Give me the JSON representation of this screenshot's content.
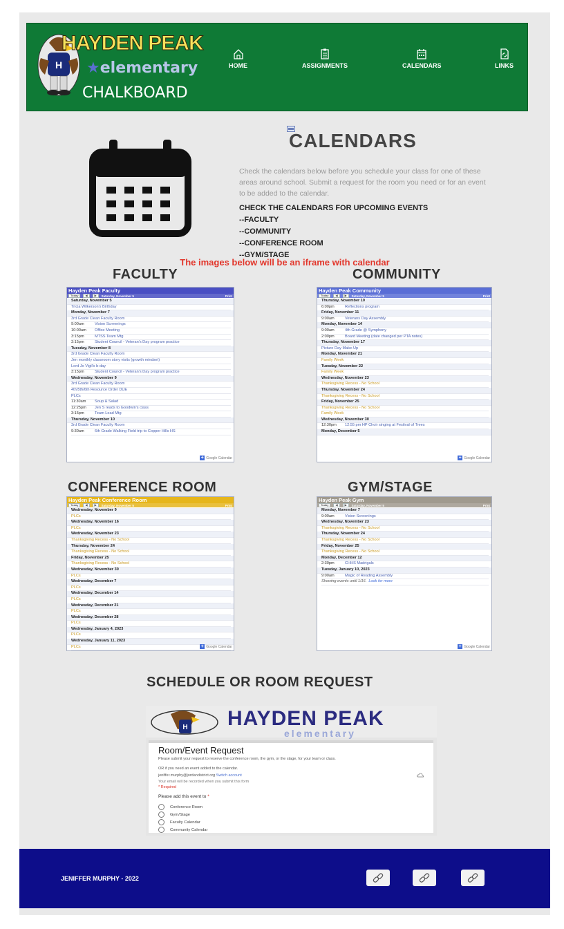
{
  "header": {
    "logo": {
      "line1": "HAYDEN PEAK",
      "line2": "elementary",
      "line3": "CHALKBOARD"
    },
    "nav": [
      {
        "label": "HOME",
        "icon": "home-icon"
      },
      {
        "label": "ASSIGNMENTS",
        "icon": "clipboard-icon"
      },
      {
        "label": "CALENDARS",
        "icon": "calendar-icon"
      },
      {
        "label": "LINKS",
        "icon": "link-doc-icon"
      }
    ]
  },
  "hero": {
    "title": "CALENDARS",
    "description": "Check the calendars below before you schedule your class for one of these areas around school. Submit a request for the room you need or for an event to be added to the calendar.",
    "list_heading": "CHECK THE CALENDARS FOR UPCOMING EVENTS",
    "list": [
      "--FACULTY",
      "--COMMUNITY",
      "--CONFERENCE ROOM",
      "--GYM/STAGE"
    ]
  },
  "notice": "The images below will be an iframe with calendar",
  "calendars": {
    "faculty": {
      "section_title": "FACULTY",
      "name": "Hayden Peak Faculty",
      "date": "Saturday, November 5",
      "rows": [
        {
          "day": "Saturday, November 5"
        },
        {
          "text": "Tricia Wilkerson's Birthday"
        },
        {
          "day": "Monday, November 7"
        },
        {
          "text": "3rd Grade Clean Faculty Room"
        },
        {
          "time": "9:00am",
          "text": "Vision Screenings"
        },
        {
          "time": "10:00am",
          "text": "Office Meeting"
        },
        {
          "time": "3:15pm",
          "text": "MTSS Team Mtg"
        },
        {
          "time": "3:15pm",
          "text": "Student Council - Veteran's Day program practice"
        },
        {
          "day": "Tuesday, November 8"
        },
        {
          "text": "3rd Grade Clean Faculty Room"
        },
        {
          "text": "Jen monthly classroom story visits (growth mindset)"
        },
        {
          "text": "Lord Jo Vigil's b-day"
        },
        {
          "time": "3:15pm",
          "text": "Student Council - Veteran's Day program practice"
        },
        {
          "day": "Wednesday, November 9"
        },
        {
          "text": "3rd Grade Clean Faculty Room"
        },
        {
          "text": "4th/5th/6th Resource Order DUE"
        },
        {
          "text": "PLCs"
        },
        {
          "time": "11:30am",
          "text": "Soup & Salad"
        },
        {
          "time": "12:25pm",
          "text": "Jen S reads to Goodwin's class"
        },
        {
          "time": "3:15pm",
          "text": "Team Lead Mtg"
        },
        {
          "day": "Thursday, November 10"
        },
        {
          "text": "3rd Grade Clean Faculty Room"
        },
        {
          "time": "9:30am",
          "text": "6th Grade Walking Field trip to Copper Hills HS"
        }
      ]
    },
    "community": {
      "section_title": "COMMUNITY",
      "name": "Hayden Peak Community",
      "date": "Saturday, November 5",
      "rows": [
        {
          "day": "Thursday, November 10"
        },
        {
          "time": "6:00pm",
          "text": "Reflections program"
        },
        {
          "day": "Friday, November 11"
        },
        {
          "time": "9:00am",
          "text": "Veterans Day Assembly"
        },
        {
          "day": "Monday, November 14"
        },
        {
          "time": "9:00am",
          "text": "4th Grade @ Symphony"
        },
        {
          "time": "2:00pm",
          "text": "Board Meeting (date changed per PTA notes)"
        },
        {
          "day": "Thursday, November 17"
        },
        {
          "text": "Picture Day Make-Up"
        },
        {
          "day": "Monday, November 21"
        },
        {
          "text": "Family Week",
          "muted": true
        },
        {
          "day": "Tuesday, November 22"
        },
        {
          "text": "Family Week",
          "muted": true
        },
        {
          "day": "Wednesday, November 23"
        },
        {
          "text": "Thanksgiving Recess - No School",
          "muted": true
        },
        {
          "day": "Thursday, November 24"
        },
        {
          "text": "Thanksgiving Recess - No School",
          "muted": true
        },
        {
          "day": "Friday, November 25"
        },
        {
          "text": "Thanksgiving Recess - No School",
          "muted": true
        },
        {
          "text": "Family Week",
          "muted": true
        },
        {
          "day": "Wednesday, November 30"
        },
        {
          "time": "12:30pm",
          "text": "12:55 pm HP Choir singing at Festival of Trees"
        },
        {
          "day": "Monday, December 5"
        }
      ]
    },
    "conference": {
      "section_title": "CONFERENCE ROOM",
      "name": "Hayden Peak Conference Room",
      "date": "Saturday, November 5",
      "rows": [
        {
          "day": "Wednesday, November 9"
        },
        {
          "text": "PLCs",
          "muted": true
        },
        {
          "day": "Wednesday, November 16"
        },
        {
          "text": "PLCs",
          "muted": true
        },
        {
          "day": "Wednesday, November 23"
        },
        {
          "text": "Thanksgiving Recess - No School",
          "muted": true
        },
        {
          "day": "Thursday, November 24"
        },
        {
          "text": "Thanksgiving Recess - No School",
          "muted": true
        },
        {
          "day": "Friday, November 25"
        },
        {
          "text": "Thanksgiving Recess - No School",
          "muted": true
        },
        {
          "day": "Wednesday, November 30"
        },
        {
          "text": "PLCs",
          "muted": true
        },
        {
          "day": "Wednesday, December 7"
        },
        {
          "text": "PLCs",
          "muted": true
        },
        {
          "day": "Wednesday, December 14"
        },
        {
          "text": "PLCs",
          "muted": true
        },
        {
          "day": "Wednesday, December 21"
        },
        {
          "text": "PLCs",
          "muted": true
        },
        {
          "day": "Wednesday, December 28"
        },
        {
          "text": "PLCs",
          "muted": true
        },
        {
          "day": "Wednesday, January 4, 2023"
        },
        {
          "text": "PLCs",
          "muted": true
        },
        {
          "day": "Wednesday, January 11, 2023"
        },
        {
          "text": "PLCs",
          "muted": true
        }
      ]
    },
    "gym": {
      "section_title": "GYM/STAGE",
      "name": "Hayden Peak Gym",
      "date": "Saturday, November 5",
      "rows": [
        {
          "day": "Monday, November 7"
        },
        {
          "time": "9:00am",
          "text": "Vision Screenings"
        },
        {
          "day": "Wednesday, November 23"
        },
        {
          "text": "Thanksgiving Recess - No School",
          "muted": true
        },
        {
          "day": "Thursday, November 24"
        },
        {
          "text": "Thanksgiving Recess - No School",
          "muted": true
        },
        {
          "day": "Friday, November 25"
        },
        {
          "text": "Thanksgiving Recess - No School",
          "muted": true
        },
        {
          "day": "Monday, December 12"
        },
        {
          "time": "2:30pm",
          "text": "CHHS Madrigals"
        },
        {
          "day": "Tuesday, January 10, 2023"
        },
        {
          "time": "9:00am",
          "text": "Magic of Reading Assembly"
        }
      ],
      "footer_note": "Showing events until 1/16.",
      "footer_link": "Look for more"
    },
    "gcal_label": "Google Calendar",
    "today_label": "Today",
    "print_label": "Print"
  },
  "request": {
    "section_title": "SCHEDULE OR ROOM REQUEST",
    "banner_line1": "HAYDEN PEAK",
    "banner_line2": "elementary",
    "form_title": "Room/Event Request",
    "form_desc": "Please submit your request to reserve the conference room, the gym, or the stage, for your team or class.",
    "form_desc2": "OR if you need an event added to the calendar.",
    "account": "jeniffer.murphy@jordandistrict.org",
    "switch_label": "Switch account",
    "email_note": "Your email will be recorded when you submit this form",
    "required": "* Required",
    "question": "Please add this event to",
    "options": [
      "Conference Room",
      "Gym/Stage",
      "Faculty Calendar",
      "Community Calendar"
    ]
  },
  "footer": {
    "credit": "JENIFFER MURPHY - 2022",
    "social_icons": [
      "link-icon",
      "link-icon",
      "link-icon"
    ]
  },
  "colors": {
    "header_green": "#0f7a36",
    "footer_navy": "#0d0d8a",
    "notice_red": "#e2362b",
    "faculty_bar": "#4a4fc3",
    "community_bar": "#5a6ed6",
    "conference_bar": "#e6b61c",
    "gym_bar": "#a09a8e"
  }
}
